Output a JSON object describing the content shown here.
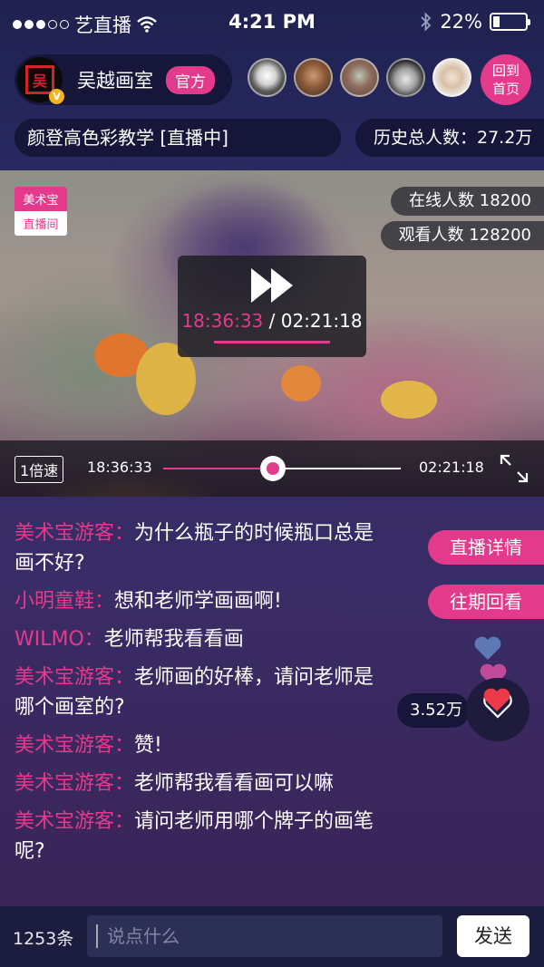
{
  "status_bar": {
    "carrier": "艺直播",
    "time": "4:21 PM",
    "battery": "22%",
    "battery_level": 0.22
  },
  "host": {
    "name": "吴越画室",
    "badge": "官方",
    "logo_text": "吴",
    "verified": "V"
  },
  "viewer_avatars": [
    "avatar-cat",
    "avatar-man-1",
    "avatar-man-2",
    "avatar-man-3",
    "avatar-man-4"
  ],
  "back_home": {
    "line1": "回到",
    "line2": "首页"
  },
  "live_title": "颜登高色彩教学 [直播中]",
  "history_total": "历史总人数：27.2万",
  "video": {
    "brand_tag": {
      "line1": "美术宝",
      "line2": "直播间"
    },
    "online": "在线人数 18200",
    "watched": "观看人数 128200",
    "current_time": "18:36:33",
    "duration": "/ 02:21:18",
    "speed": "1倍速",
    "bar_current": "18:36:33",
    "bar_total": "02:21:18",
    "progress": 0.46
  },
  "chat": [
    {
      "user": "美术宝游客：",
      "text": "为什么瓶子的时候瓶口总是画不好?"
    },
    {
      "user": "小明童鞋：",
      "text": "想和老师学画画啊!"
    },
    {
      "user": "WILMO：",
      "text": "老师帮我看看画"
    },
    {
      "user": "美术宝游客：",
      "text": "老师画的好棒，请问老师是哪个画室的?"
    },
    {
      "user": "美术宝游客：",
      "text": "赞!"
    },
    {
      "user": "美术宝游客：",
      "text": "老师帮我看看画可以嘛"
    },
    {
      "user": "美术宝游客：",
      "text": "请问老师用哪个牌子的画笔呢?"
    }
  ],
  "side_buttons": {
    "details": "直播详情",
    "replay": "往期回看"
  },
  "likes": "3.52万",
  "bottom": {
    "count": "1253条",
    "placeholder": "说点什么",
    "send": "发送"
  },
  "colors": {
    "accent": "#e43a8b",
    "panel": "#15163a",
    "background": "#2a2a62"
  }
}
